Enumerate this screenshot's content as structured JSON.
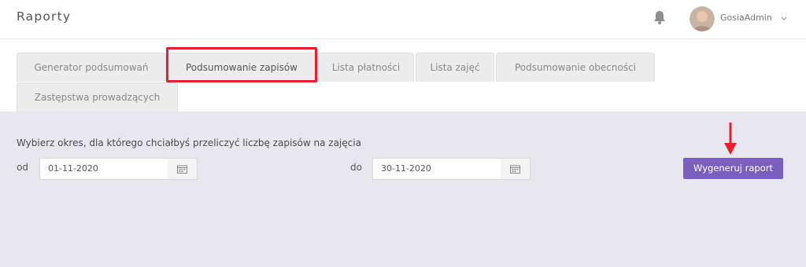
{
  "header": {
    "title": "Raporty",
    "username": "GosiaAdmin",
    "icons": {
      "notification": "bell-icon",
      "menu": "chevron-down-icon"
    }
  },
  "tabs": [
    {
      "label": "Generator podsumowań"
    },
    {
      "label": "Podsumowanie zapisów"
    },
    {
      "label": "Lista płatności"
    },
    {
      "label": "Lista zajęć"
    },
    {
      "label": "Podsumowanie obecności"
    },
    {
      "label": "Zastępstwa prowadzących"
    }
  ],
  "main": {
    "instruction": "Wybierz okres, dla którego chciałbyś przeliczyć liczbę zapisów na zajęcia",
    "from_label": "od",
    "from_value": "01-11-2020",
    "to_label": "do",
    "to_value": "30-11-2020",
    "generate_label": "Wygeneruj raport"
  },
  "colors": {
    "accent": "#7b5fbf",
    "annotation": "#e8202a",
    "panel": "#e8e6ef"
  }
}
